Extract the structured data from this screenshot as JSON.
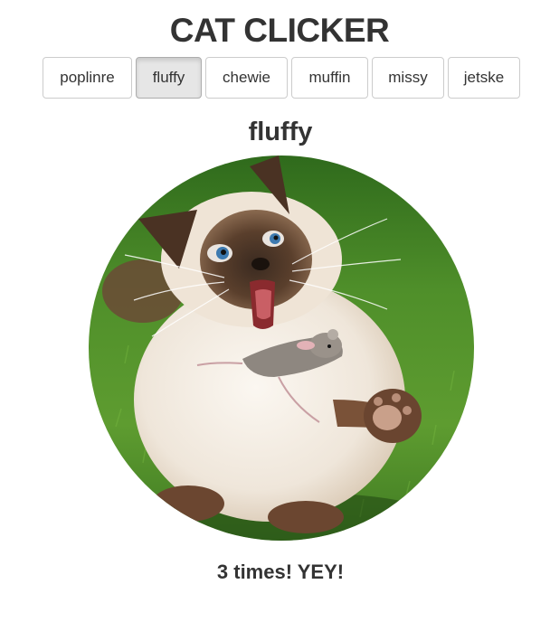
{
  "header": {
    "title": "CAT CLICKER"
  },
  "cats": [
    {
      "label": "poplinre",
      "active": false
    },
    {
      "label": "fluffy",
      "active": true
    },
    {
      "label": "chewie",
      "active": false
    },
    {
      "label": "muffin",
      "active": false
    },
    {
      "label": "missy",
      "active": false
    },
    {
      "label": "jetske",
      "active": false
    }
  ],
  "current_cat": {
    "name": "fluffy",
    "click_text": "3 times! YEY!",
    "image_subject": "siamese-cat-catching-mouse"
  },
  "colors": {
    "text": "#333333",
    "button_border": "#cccccc",
    "active_button_bg": "#e6e6e6",
    "grass": "#4a8a28"
  }
}
